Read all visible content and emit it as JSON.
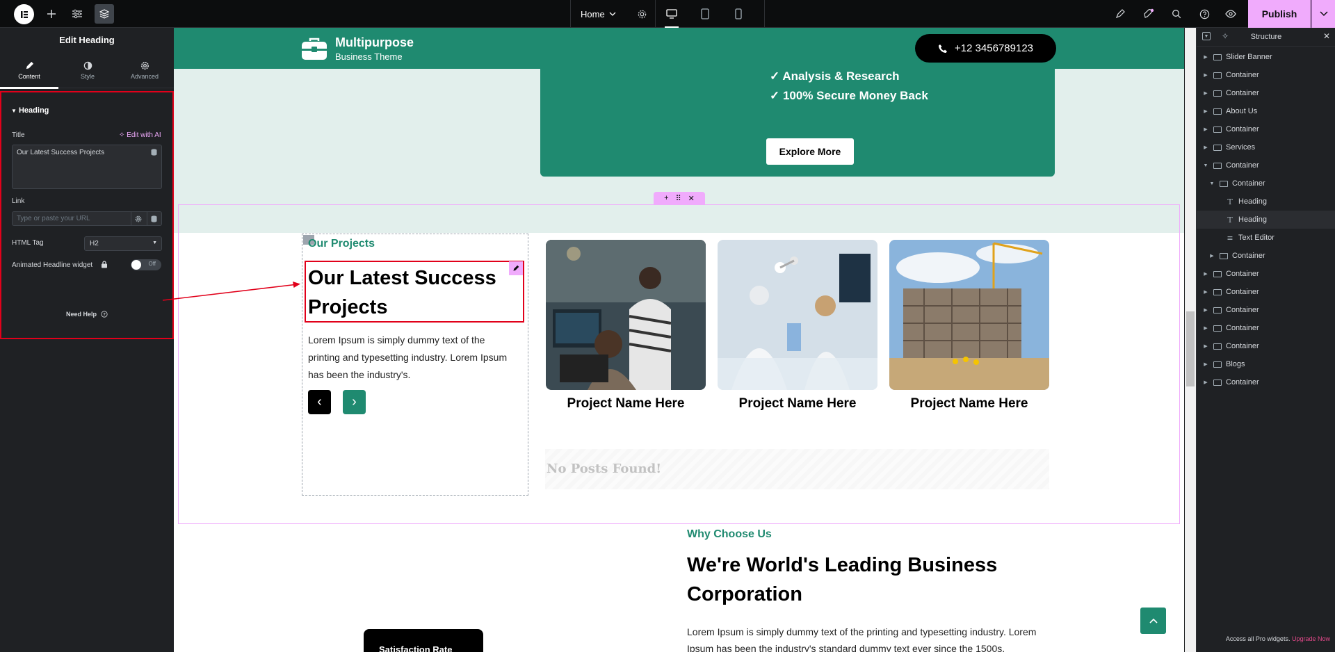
{
  "topbar": {
    "page_name": "Home",
    "publish_label": "Publish"
  },
  "left_panel": {
    "title": "Edit Heading",
    "tabs": [
      {
        "label": "Content"
      },
      {
        "label": "Style"
      },
      {
        "label": "Advanced"
      }
    ],
    "section_label": "Heading",
    "title_label": "Title",
    "edit_ai_label": "Edit with AI",
    "title_value": "Our Latest Success Projects",
    "link_label": "Link",
    "link_placeholder": "Type or paste your URL",
    "html_tag_label": "HTML Tag",
    "html_tag_value": "H2",
    "animated_label": "Animated Headline widget",
    "toggle_label": "Off",
    "need_help": "Need Help"
  },
  "site": {
    "brand_name": "Multipurpose",
    "brand_sub": "Business Theme",
    "phone": "+12 3456789123",
    "hero_lines": [
      "✓ Analysis & Research",
      "✓ 100% Secure Money Back"
    ],
    "explore_label": "Explore More",
    "eyebrow": "Our Projects",
    "heading": "Our Latest Success Projects",
    "lead": "Lorem Ipsum is simply dummy text of the printing and typesetting industry. Lorem Ipsum has been the industry's.",
    "projects": [
      {
        "name": "Project Name Here"
      },
      {
        "name": "Project Name Here"
      },
      {
        "name": "Project Name Here"
      }
    ],
    "no_posts": "No Posts Found!",
    "why_eyebrow": "Why Choose Us",
    "why_heading": "We're World's Leading Business Corporation",
    "why_text": "Lorem Ipsum is simply dummy text of the printing and typesetting industry. Lorem Ipsum has been the industry's standard dummy text ever since the 1500s.",
    "stat_card": "Satisfaction Rate"
  },
  "structure": {
    "title": "Structure",
    "items": [
      {
        "label": "Slider Banner",
        "caret": "▶",
        "type": "container"
      },
      {
        "label": "Container",
        "caret": "▶",
        "type": "container"
      },
      {
        "label": "Container",
        "caret": "▶",
        "type": "container"
      },
      {
        "label": "About Us",
        "caret": "▶",
        "type": "container"
      },
      {
        "label": "Container",
        "caret": "▶",
        "type": "container"
      },
      {
        "label": "Services",
        "caret": "▶",
        "type": "container"
      },
      {
        "label": "Container",
        "caret": "▼",
        "type": "container"
      },
      {
        "label": "Container",
        "caret": "▼",
        "type": "container"
      },
      {
        "label": "Heading",
        "caret": "",
        "type": "heading"
      },
      {
        "label": "Heading",
        "caret": "",
        "type": "heading"
      },
      {
        "label": "Text Editor",
        "caret": "",
        "type": "text"
      },
      {
        "label": "Container",
        "caret": "▶",
        "type": "container"
      },
      {
        "label": "Container",
        "caret": "▶",
        "type": "container"
      },
      {
        "label": "Container",
        "caret": "▶",
        "type": "container"
      },
      {
        "label": "Container",
        "caret": "▶",
        "type": "container"
      },
      {
        "label": "Container",
        "caret": "▶",
        "type": "container"
      },
      {
        "label": "Container",
        "caret": "▶",
        "type": "container"
      },
      {
        "label": "Blogs",
        "caret": "▶",
        "type": "container"
      },
      {
        "label": "Container",
        "caret": "▶",
        "type": "container"
      }
    ],
    "footer_text": "Access all Pro widgets.",
    "footer_link": "Upgrade Now"
  },
  "colors": {
    "accent_green": "#1f8a70",
    "publish_pink": "#f0abfc",
    "highlight_red": "#e1001a"
  }
}
